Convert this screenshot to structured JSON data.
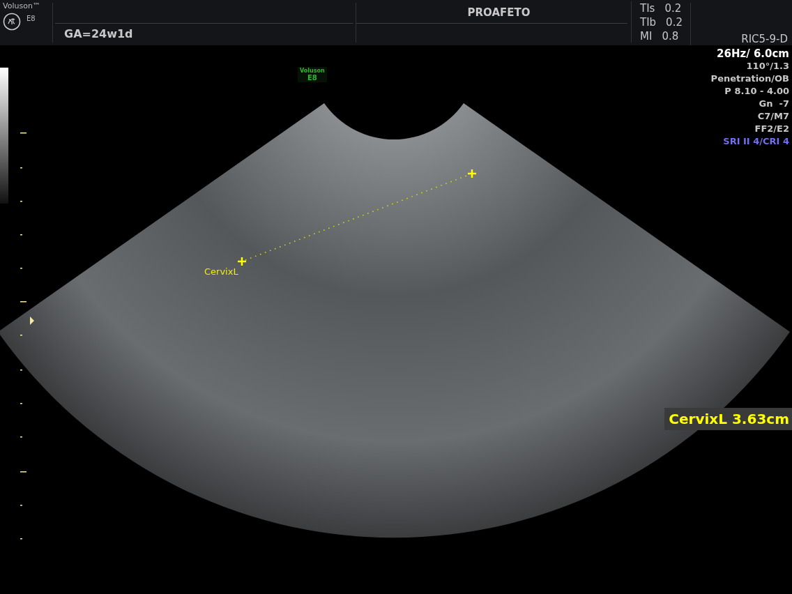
{
  "header": {
    "brand": "Voluson™",
    "model": "E8",
    "ga": "GA=24w1d",
    "patient": "PROAFETO",
    "indices": [
      {
        "label": "TIs",
        "value": "0.2"
      },
      {
        "label": "TIb",
        "value": "0.2"
      },
      {
        "label": "MI",
        "value": "0.8"
      }
    ],
    "probe": "RIC5-9-D"
  },
  "params": [
    {
      "text": "26Hz/ 6.0cm",
      "kind": "main",
      "color": "#ffffff"
    },
    {
      "text": "110°/1.3",
      "kind": "normal",
      "color": "#c8c8c8"
    },
    {
      "text": "Penetration/OB",
      "kind": "normal",
      "color": "#c8c8c8"
    },
    {
      "text": "P 8.10 - 4.00",
      "kind": "normal",
      "color": "#c8c8c8"
    },
    {
      "text": "Gn  -7",
      "kind": "normal",
      "color": "#c8c8c8"
    },
    {
      "text": "C7/M7",
      "kind": "normal",
      "color": "#c8c8c8"
    },
    {
      "text": "FF2/E2",
      "kind": "normal",
      "color": "#c8c8c8"
    },
    {
      "text": "SRI II 4/CRI 4",
      "kind": "normal",
      "color": "#7070f0"
    }
  ],
  "image_badge": {
    "brand": "Voluson",
    "model": "E8"
  },
  "measurement": {
    "label": "CervixL",
    "result": "CervixL 3.63cm"
  }
}
